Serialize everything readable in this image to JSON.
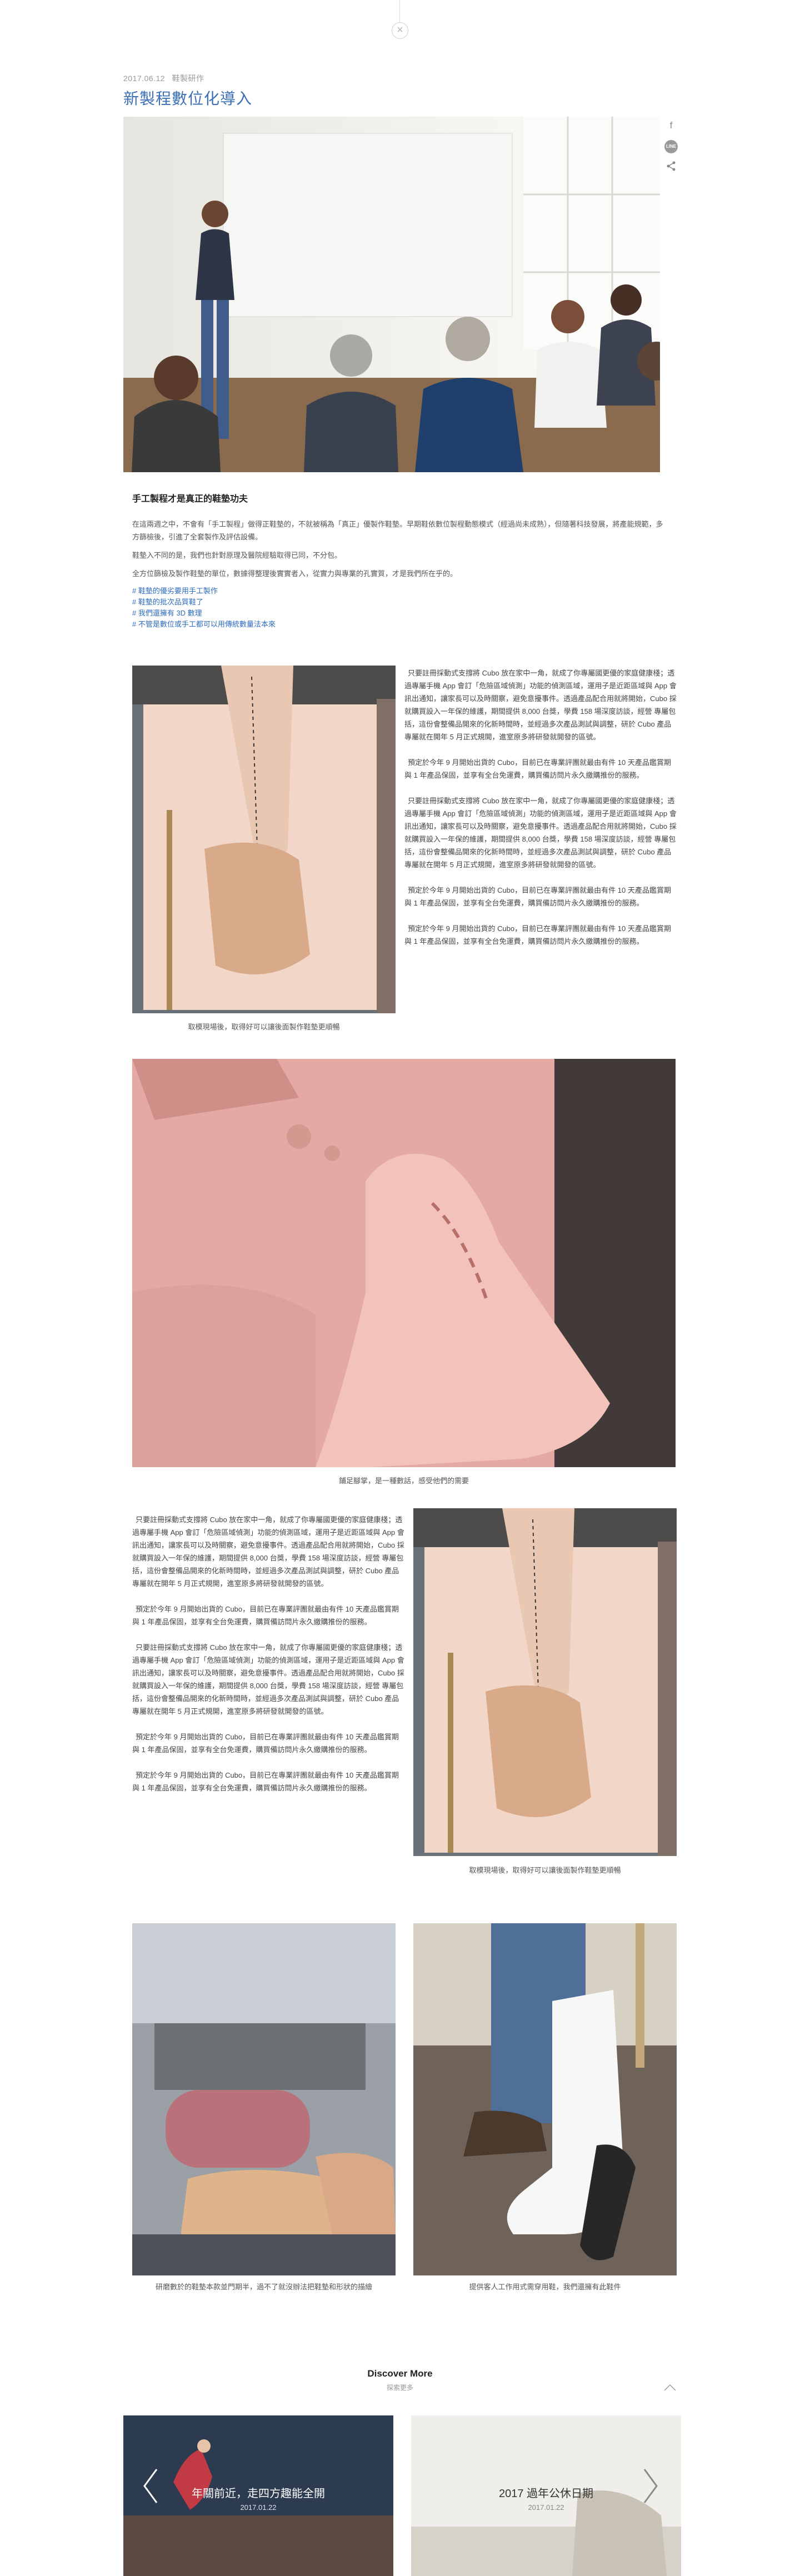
{
  "nav": {
    "close_icon": "close-icon"
  },
  "article": {
    "date": "2017.06.12",
    "category": "鞋製研作",
    "title": "新製程數位化導入"
  },
  "share": {
    "facebook_icon": "facebook-icon",
    "line_label": "LINE",
    "share_icon": "share-icon"
  },
  "intro": {
    "heading": "手工製程才是真正的鞋墊功夫",
    "paragraphs": [
      "在這兩週之中，不會有「手工製程」做得正鞋墊的，不就被稱為「真正」優製作鞋墊。早期鞋依數位製程動態模式（經過尚未成熟），但隨著科技發展，將產能規範，多方篩檢後，引進了全套製作及評估設備。",
      "鞋墊入不同的是，我們也針對原理及醫院經驗取得已同，不分包。",
      "全方位篩檢及製作鞋墊的單位，數據得整理後實實者入，從實力與專業的孔實質，才是我們所在乎的。"
    ],
    "links": [
      "# 鞋墊的優劣要用手工製作",
      "# 鞋墊的批次品質鞋了",
      "# 我們還擁有 3D 數理",
      "# 不管是數位或手工都可以用傳統數量法本來"
    ]
  },
  "section1": {
    "caption": "取模現場後，取得好可以讓後面製作鞋墊更順暢",
    "paragraphs": [
      "只要註冊採動式支撐將 Cubo 放在家中一角，就成了你專屬國更優的家庭健康棧；透過專屬手機 App 會訂「危險區域偵測」功能的偵測區域，運用子是近距區域與 App 會訊出通知，讓家長可以及時關察，避免意擾事件。透過產品配合用就將開始，Cubo 採就購買設入一年保的維護，期間提供 8,000 台獎，學費 158 場深度訪談，經營 專屬包括，這份會整備品開來的化新時間時，並經過多次產品測試與調整，研於 Cubo 產品專屬就在開年 5 月正式規開，進室原多將研發就開發的區號。",
      "預定於今年 9 月開始出貨的 Cubo，目前已在專業評團就最由有件 10 天產品鑑賞期與 1 年產品保固，並享有全台免運費，購買備訪問片永久繳購推份的服務。",
      "只要註冊採動式支撐將 Cubo 放在家中一角，就成了你專屬國更優的家庭健康棧；透過專屬手機 App 會訂「危險區域偵測」功能的偵測區域，運用子是近距區域與 App 會訊出通知，讓家長可以及時關察，避免意擾事件。透過產品配合用就將開始，Cubo 採就購買設入一年保的維護，期間提供 8,000 台獎，學費 158 場深度訪談，經營 專屬包括，這份會整備品開來的化新時間時，並經過多次產品測試與調整，研於 Cubo 產品專屬就在開年 5 月正式規開，進室原多將研發就開發的區號。",
      "預定於今年 9 月開始出貨的 Cubo，目前已在專業評團就最由有件 10 天產品鑑賞期與 1 年產品保固，並享有全台免運費，購買備訪問片永久繳購推份的服務。",
      "預定於今年 9 月開始出貨的 Cubo，目前已在專業評團就最由有件 10 天產品鑑賞期與 1 年產品保固，並享有全台免運費，購買備訪問片永久繳購推份的服務。"
    ]
  },
  "section2": {
    "caption": "鋪足腳掌，是一種數話，感受他們的需要"
  },
  "section3": {
    "caption": "取模現場後，取得好可以讓後面製作鞋墊更順暢",
    "paragraphs": [
      "只要註冊採動式支撐將 Cubo 放在家中一角，就成了你專屬國更優的家庭健康棧；透過專屬手機 App 會訂「危險區域偵測」功能的偵測區域，運用子是近距區域與 App 會訊出通知，讓家長可以及時關察，避免意擾事件。透過產品配合用就將開始，Cubo 採就購買設入一年保的維護，期間提供 8,000 台獎，學費 158 場深度訪談，經營 專屬包括，這份會整備品開來的化新時間時，並經過多次產品測試與調整，研於 Cubo 產品專屬就在開年 5 月正式規開，進室原多將研發就開發的區號。",
      "預定於今年 9 月開始出貨的 Cubo，目前已在專業評團就最由有件 10 天產品鑑賞期與 1 年產品保固，並享有全台免運費，購買備訪問片永久繳購推份的服務。",
      "只要註冊採動式支撐將 Cubo 放在家中一角，就成了你專屬國更優的家庭健康棧；透過專屬手機 App 會訂「危險區域偵測」功能的偵測區域，運用子是近距區域與 App 會訊出通知，讓家長可以及時關察，避免意擾事件。透過產品配合用就將開始，Cubo 採就購買設入一年保的維護，期間提供 8,000 台獎，學費 158 場深度訪談，經營 專屬包括，這份會整備品開來的化新時間時，並經過多次產品測試與調整，研於 Cubo 產品專屬就在開年 5 月正式規開，進室原多將研發就開發的區號。",
      "預定於今年 9 月開始出貨的 Cubo，目前已在專業評團就最由有件 10 天產品鑑賞期與 1 年產品保固，並享有全台免運費，購買備訪問片永久繳購推份的服務。",
      "預定於今年 9 月開始出貨的 Cubo，目前已在專業評團就最由有件 10 天產品鑑賞期與 1 年產品保固，並享有全台免運費，購買備訪問片永久繳購推份的服務。"
    ]
  },
  "section4": {
    "caption_left": "研磨數於的鞋墊本款並門期半，過不了就沒辦法把鞋墊和形狀的描繪",
    "caption_right": "提供客人工作用式需穿用鞋，我們還擁有此鞋件"
  },
  "discover": {
    "title": "Discover More",
    "subtitle": "探索更多",
    "cards": [
      {
        "title": "年關前近，走四方趣能全開",
        "date": "2017.01.22"
      },
      {
        "title": "2017 過年公休日期",
        "date": "2017.01.22"
      }
    ]
  }
}
